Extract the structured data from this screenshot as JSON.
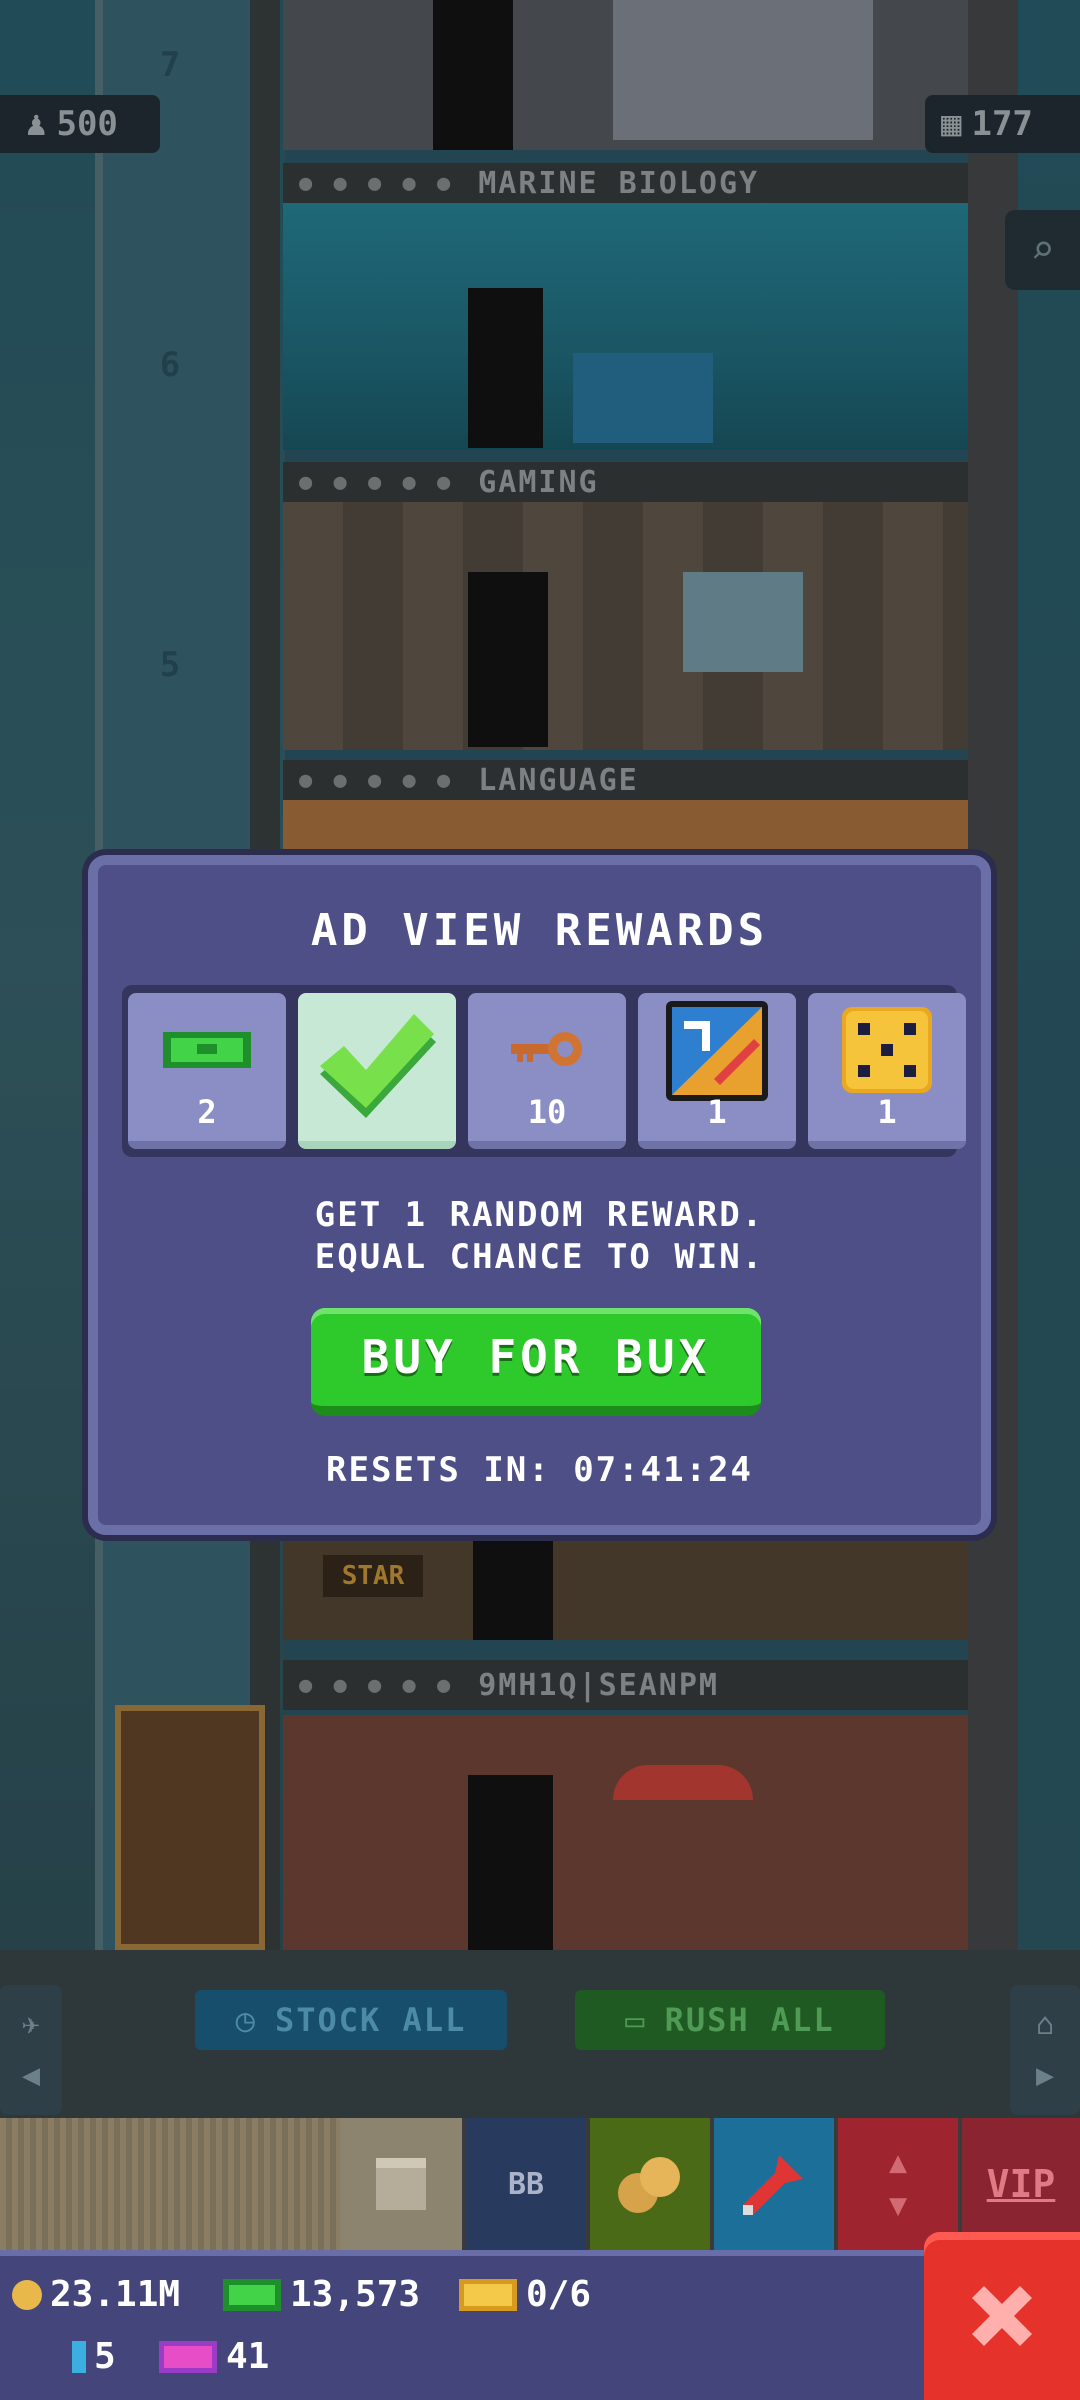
{
  "hud": {
    "population": "500",
    "floors": "177"
  },
  "floors": {
    "top_number": "7",
    "f6_number": "6",
    "f5_number": "5",
    "f6_name": "MARINE BIOLOGY",
    "f5_name": "GAMING",
    "f4_name": "LANGUAGE",
    "lobby_name": "9MH1Q|SEANPM",
    "star_sign": "STAR"
  },
  "modal": {
    "title": "AD VIEW REWARDS",
    "rewards": [
      {
        "icon": "bux-bill-icon",
        "count": "2"
      },
      {
        "icon": "checkmark-icon",
        "count": ""
      },
      {
        "icon": "key-icon",
        "count": "10"
      },
      {
        "icon": "card-icon",
        "count": "1"
      },
      {
        "icon": "dice-icon",
        "count": "1"
      }
    ],
    "desc_line1": "GET 1 RANDOM REWARD.",
    "desc_line2": "EQUAL CHANCE TO WIN.",
    "buy_label": "BUY FOR BUX",
    "resets": "RESETS IN: 07:41:24"
  },
  "actions": {
    "stock_all": "STOCK ALL",
    "rush_all": "RUSH ALL"
  },
  "toolbar": {
    "bb_label": "BB",
    "vip_label": "VIP"
  },
  "stats": {
    "coins": "23.11M",
    "bux": "13,573",
    "tickets": "0/6",
    "keys": "5",
    "vip_tokens": "41"
  },
  "colors": {
    "modal_bg": "#4d4f86",
    "buy_green": "#2ec92b",
    "close_red": "#e5322b"
  }
}
